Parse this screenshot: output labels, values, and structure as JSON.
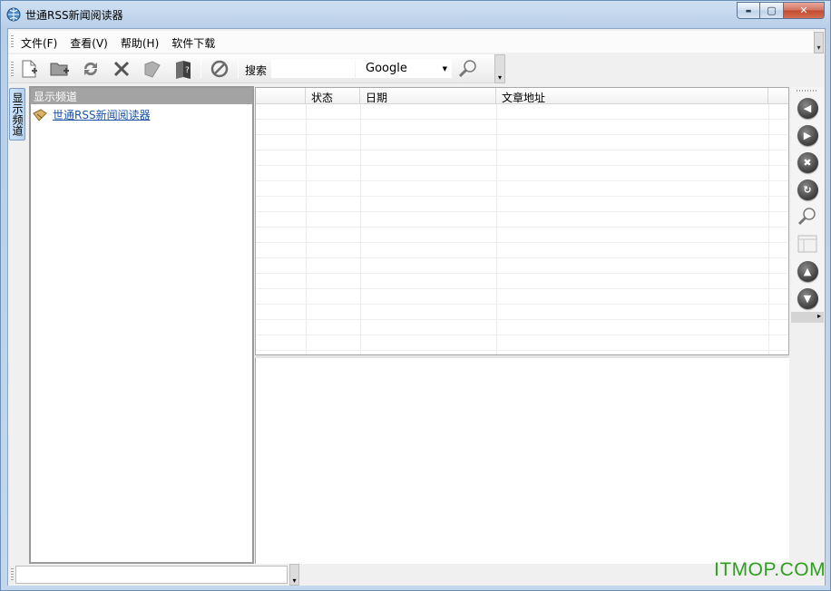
{
  "window": {
    "title": "世通RSS新闻阅读器",
    "controls": {
      "minimize": "▬",
      "maximize": "▢",
      "close": "✕"
    }
  },
  "menu": {
    "items": [
      {
        "label": "文件(F)"
      },
      {
        "label": "查看(V)"
      },
      {
        "label": "帮助(H)"
      },
      {
        "label": "软件下载"
      }
    ]
  },
  "toolbar": {
    "buttons": [
      "new-feed-icon",
      "open-folder-icon",
      "refresh-icon",
      "delete-icon",
      "cards-icon",
      "book-help-icon",
      "stop-icon"
    ],
    "search_label": "搜索",
    "search_value": "",
    "engine": "Google",
    "search_button_icon": "magnifier-icon"
  },
  "side_tab": {
    "label": "显示频道"
  },
  "channel_panel": {
    "title": "显示频道",
    "items": [
      {
        "label": "世通RSS新闻阅读器",
        "icon": "rss-folder-icon"
      }
    ]
  },
  "article_list": {
    "columns": [
      {
        "label": ""
      },
      {
        "label": "状态"
      },
      {
        "label": "日期"
      },
      {
        "label": "文章地址"
      }
    ],
    "rows": []
  },
  "nav_toolbar": {
    "buttons": [
      "back-icon",
      "forward-icon",
      "stop-icon",
      "reload-icon",
      "zoom-icon",
      "layout-icon",
      "up-icon",
      "down-icon"
    ]
  },
  "status": {
    "text": ""
  },
  "watermark": "ITMOP.COM",
  "colors": {
    "titlebar": "#cfe0f3",
    "link": "#1a53a6",
    "watermark": "#2e9e1e",
    "panel_header": "#a3a3a3"
  }
}
